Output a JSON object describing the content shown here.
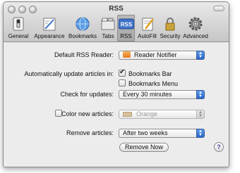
{
  "window": {
    "title": "RSS"
  },
  "toolbar": {
    "items": [
      {
        "label": "General",
        "icon": "general-switch-icon"
      },
      {
        "label": "Appearance",
        "icon": "appearance-pen-icon"
      },
      {
        "label": "Bookmarks",
        "icon": "bookmarks-globe-icon"
      },
      {
        "label": "Tabs",
        "icon": "tabs-icon"
      },
      {
        "label": "RSS",
        "icon": "rss-icon",
        "icon_text": "RSS",
        "selected": true
      },
      {
        "label": "AutoFill",
        "icon": "autofill-pencil-icon"
      },
      {
        "label": "Security",
        "icon": "security-lock-icon"
      },
      {
        "label": "Advanced",
        "icon": "advanced-gear-icon"
      }
    ]
  },
  "settings": {
    "default_reader": {
      "label": "Default RSS Reader:",
      "value": "Reader Notifier"
    },
    "auto_update": {
      "label": "Automatically update articles in:",
      "options": [
        {
          "label": "Bookmarks Bar",
          "checked": true
        },
        {
          "label": "Bookmarks Menu",
          "checked": false
        }
      ]
    },
    "check_updates": {
      "label": "Check for updates:",
      "value": "Every 30 minutes"
    },
    "color_new": {
      "label": "Color new articles:",
      "checked": false,
      "value": "Orange",
      "swatch_color": "#d9c09c"
    },
    "remove_articles": {
      "label": "Remove articles:",
      "value": "After two weeks"
    },
    "remove_now_button": "Remove Now",
    "help_button": "?"
  },
  "colors": {
    "accent": "#2b66c8",
    "rss_orange": "#e5761e"
  }
}
